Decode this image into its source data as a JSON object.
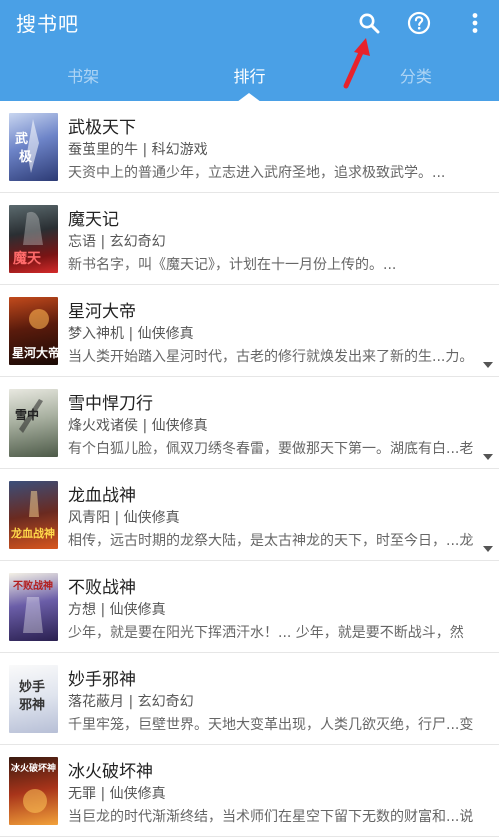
{
  "app": {
    "title": "搜书吧"
  },
  "toolbar": {
    "icons": [
      "search-icon",
      "help-icon",
      "more-vert-icon"
    ]
  },
  "tabs": [
    {
      "label": "书架",
      "active": false
    },
    {
      "label": "排行",
      "active": true
    },
    {
      "label": "分类",
      "active": false
    }
  ],
  "colors": {
    "primary": "#4aa0e6",
    "arrow": "#e8222c"
  },
  "books": [
    {
      "title": "武极天下",
      "meta": "蚕茧里的牛 | 科幻游戏",
      "desc": "天资中上的普通少年，立志进入武府圣地，追求极致武学。...",
      "cover_text": "武极天下"
    },
    {
      "title": "魔天记",
      "meta": "忘语 | 玄幻奇幻",
      "desc": "新书名字，叫《魔天记》，计划在十一月份上传的。...",
      "cover_text": "魔天记"
    },
    {
      "title": "星河大帝",
      "meta": "梦入神机 | 仙侠修真",
      "desc": "当人类开始踏入星河时代，古老的修行就焕发出来了新的生...力。",
      "cover_text": "星河大帝"
    },
    {
      "title": "雪中悍刀行",
      "meta": "烽火戏诸侯 | 仙侠修真",
      "desc": "有个白狐儿脸，佩双刀绣冬春雷，要做那天下第一。湖底有白...老",
      "cover_text": "雪中悍刀行"
    },
    {
      "title": "龙血战神",
      "meta": "风青阳 | 仙侠修真",
      "desc": "相传，远古时期的龙祭大陆，是太古神龙的天下，时至今日，...龙",
      "cover_text": "龙血战神"
    },
    {
      "title": "不败战神",
      "meta": "方想 | 仙侠修真",
      "desc": "少年，就是要在阳光下挥洒汗水！... 少年，就是要不断战斗，然",
      "cover_text": "不败战神"
    },
    {
      "title": "妙手邪神",
      "meta": "落花蔽月 | 玄幻奇幻",
      "desc": "千里牢笼，巨壁世界。天地大变革出现，人类几欲灭绝，行尸...变",
      "cover_text": "妙手邪神"
    },
    {
      "title": "冰火破坏神",
      "meta": "无罪 | 仙侠修真",
      "desc": "当巨龙的时代渐渐终结，当术师们在星空下留下无数的财富和...说",
      "cover_text": "冰火破坏神"
    }
  ]
}
